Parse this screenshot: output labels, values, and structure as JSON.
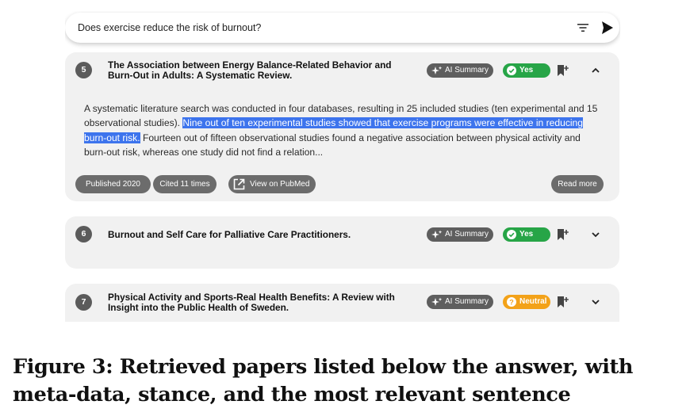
{
  "search": {
    "query": "Does exercise reduce the risk of burnout?",
    "filter_icon": "filter-icon",
    "send_icon": "send-icon"
  },
  "papers": [
    {
      "number": "5",
      "title": "The Association between Energy Balance-Related Behavior and Burn-Out in Adults: A Systematic Review.",
      "ai_label": "AI Summary",
      "stance": "Yes",
      "stance_color": "#27a547",
      "expanded": true,
      "chevron": "chevron-up-icon",
      "abstract_before": "A systematic literature search was conducted in four databases, resulting in 25 included studies (ten experimental and 15 observational studies). ",
      "abstract_highlight": "Nine out of ten experimental studies showed that exercise programs were effective in reducing burn-out risk.",
      "abstract_after": " Fourteen out of fifteen observational studies found a negative association between physical activity and burn-out risk, whereas one study did not find a relation...",
      "published": "Published 2020",
      "cited": "Cited 11 times",
      "pubmed": "View on PubMed",
      "read_more": "Read more"
    },
    {
      "number": "6",
      "title": "Burnout and Self Care for Palliative Care Practitioners.",
      "ai_label": "AI Summary",
      "stance": "Yes",
      "stance_color": "#27a547",
      "expanded": false,
      "chevron": "chevron-down-icon"
    },
    {
      "number": "7",
      "title": "Physical Activity and Sports-Real Health Benefits: A Review with Insight into the Public Health of Sweden.",
      "ai_label": "AI Summary",
      "stance": "Neutral",
      "stance_color": "#f3a219",
      "expanded": false,
      "chevron": "chevron-down-icon"
    }
  ],
  "caption": "Figure 3: Retrieved papers listed below the answer, with meta-data, stance, and the most relevant sentence"
}
